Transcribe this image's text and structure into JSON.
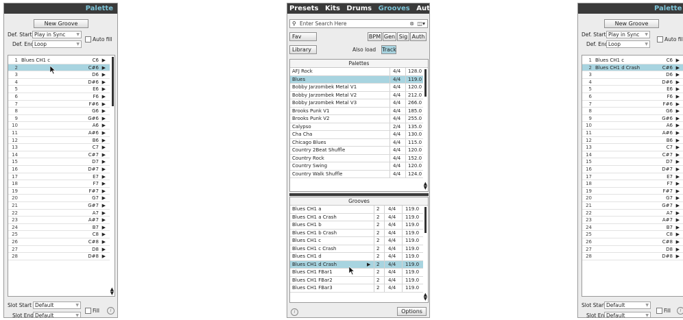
{
  "left": {
    "title": "Palette",
    "new_groove": "New Groove",
    "def_start_label": "Def. Start",
    "def_start_value": "Play in Sync",
    "def_end_label": "Def. End",
    "def_end_value": "Loop",
    "auto_fill": "Auto fill",
    "slot_start_label": "Slot Start",
    "slot_start_value": "Default",
    "slot_end_label": "Slot End",
    "slot_end_value": "Default",
    "fill": "Fill",
    "slots": [
      {
        "n": "1",
        "name": "Blues CH1 c",
        "chord": "C6"
      },
      {
        "n": "2",
        "name": "",
        "chord": "C#6"
      },
      {
        "n": "3",
        "name": "",
        "chord": "D6"
      },
      {
        "n": "4",
        "name": "",
        "chord": "D#6"
      },
      {
        "n": "5",
        "name": "",
        "chord": "E6"
      },
      {
        "n": "6",
        "name": "",
        "chord": "F6"
      },
      {
        "n": "7",
        "name": "",
        "chord": "F#6"
      },
      {
        "n": "8",
        "name": "",
        "chord": "G6"
      },
      {
        "n": "9",
        "name": "",
        "chord": "G#6"
      },
      {
        "n": "10",
        "name": "",
        "chord": "A6"
      },
      {
        "n": "11",
        "name": "",
        "chord": "A#6"
      },
      {
        "n": "12",
        "name": "",
        "chord": "B6"
      },
      {
        "n": "13",
        "name": "",
        "chord": "C7"
      },
      {
        "n": "14",
        "name": "",
        "chord": "C#7"
      },
      {
        "n": "15",
        "name": "",
        "chord": "D7"
      },
      {
        "n": "16",
        "name": "",
        "chord": "D#7"
      },
      {
        "n": "17",
        "name": "",
        "chord": "E7"
      },
      {
        "n": "18",
        "name": "",
        "chord": "F7"
      },
      {
        "n": "19",
        "name": "",
        "chord": "F#7"
      },
      {
        "n": "20",
        "name": "",
        "chord": "G7"
      },
      {
        "n": "21",
        "name": "",
        "chord": "G#7"
      },
      {
        "n": "22",
        "name": "",
        "chord": "A7"
      },
      {
        "n": "23",
        "name": "",
        "chord": "A#7"
      },
      {
        "n": "24",
        "name": "",
        "chord": "B7"
      },
      {
        "n": "25",
        "name": "",
        "chord": "C8"
      },
      {
        "n": "26",
        "name": "",
        "chord": "C#8"
      },
      {
        "n": "27",
        "name": "",
        "chord": "D8"
      },
      {
        "n": "28",
        "name": "",
        "chord": "D#8"
      }
    ]
  },
  "right": {
    "title": "Palette",
    "new_groove": "New Groove",
    "def_start_label": "Def. Start",
    "def_start_value": "Play in Sync",
    "def_end_label": "Def. End",
    "def_end_value": "Loop",
    "auto_fill": "Auto fill",
    "slot_start_label": "Slot Start",
    "slot_start_value": "Default",
    "slot_end_label": "Slot End",
    "slot_end_value": "Default",
    "fill": "Fill",
    "slots": [
      {
        "n": "1",
        "name": "Blues CH1 c",
        "chord": "C6"
      },
      {
        "n": "2",
        "name": "Blues CH1 d Crash",
        "chord": "C#6"
      },
      {
        "n": "3",
        "name": "",
        "chord": "D6"
      },
      {
        "n": "4",
        "name": "",
        "chord": "D#6"
      },
      {
        "n": "5",
        "name": "",
        "chord": "E6"
      },
      {
        "n": "6",
        "name": "",
        "chord": "F6"
      },
      {
        "n": "7",
        "name": "",
        "chord": "F#6"
      },
      {
        "n": "8",
        "name": "",
        "chord": "G6"
      },
      {
        "n": "9",
        "name": "",
        "chord": "G#6"
      },
      {
        "n": "10",
        "name": "",
        "chord": "A6"
      },
      {
        "n": "11",
        "name": "",
        "chord": "A#6"
      },
      {
        "n": "12",
        "name": "",
        "chord": "B6"
      },
      {
        "n": "13",
        "name": "",
        "chord": "C7"
      },
      {
        "n": "14",
        "name": "",
        "chord": "C#7"
      },
      {
        "n": "15",
        "name": "",
        "chord": "D7"
      },
      {
        "n": "16",
        "name": "",
        "chord": "D#7"
      },
      {
        "n": "17",
        "name": "",
        "chord": "E7"
      },
      {
        "n": "18",
        "name": "",
        "chord": "F7"
      },
      {
        "n": "19",
        "name": "",
        "chord": "F#7"
      },
      {
        "n": "20",
        "name": "",
        "chord": "G7"
      },
      {
        "n": "21",
        "name": "",
        "chord": "G#7"
      },
      {
        "n": "22",
        "name": "",
        "chord": "A7"
      },
      {
        "n": "23",
        "name": "",
        "chord": "A#7"
      },
      {
        "n": "24",
        "name": "",
        "chord": "B7"
      },
      {
        "n": "25",
        "name": "",
        "chord": "C8"
      },
      {
        "n": "26",
        "name": "",
        "chord": "C#8"
      },
      {
        "n": "27",
        "name": "",
        "chord": "D8"
      },
      {
        "n": "28",
        "name": "",
        "chord": "D#8"
      }
    ]
  },
  "browser": {
    "tabs": [
      "Presets",
      "Kits",
      "Drums",
      "Grooves",
      "Auto"
    ],
    "active_tab": "Grooves",
    "search_placeholder": "Enter Search Here",
    "fav": "Fav",
    "bpm": "BPM",
    "gen": "Gen",
    "sig": "Sig",
    "auth": "Auth",
    "library": "Library",
    "also_load": "Also load",
    "track": "Track",
    "palettes_header": "Palettes",
    "palettes": [
      {
        "name": "AFJ Rock",
        "sig": "4/4",
        "bpm": "128.0"
      },
      {
        "name": "Blues",
        "sig": "4/4",
        "bpm": "119.0"
      },
      {
        "name": "Bobby Jarzombek Metal V1",
        "sig": "4/4",
        "bpm": "120.0"
      },
      {
        "name": "Bobby Jarzombek Metal V2",
        "sig": "4/4",
        "bpm": "212.0"
      },
      {
        "name": "Bobby Jarzombek Metal V3",
        "sig": "4/4",
        "bpm": "266.0"
      },
      {
        "name": "Brooks Punk V1",
        "sig": "4/4",
        "bpm": "185.0"
      },
      {
        "name": "Brooks Punk V2",
        "sig": "4/4",
        "bpm": "255.0"
      },
      {
        "name": "Calypso",
        "sig": "2/4",
        "bpm": "135.0"
      },
      {
        "name": "Cha Cha",
        "sig": "4/4",
        "bpm": "130.0"
      },
      {
        "name": "Chicago Blues",
        "sig": "4/4",
        "bpm": "115.0"
      },
      {
        "name": "Country 2Beat Shuffle",
        "sig": "4/4",
        "bpm": "120.0"
      },
      {
        "name": "Country Rock",
        "sig": "4/4",
        "bpm": "152.0"
      },
      {
        "name": "Country Swing",
        "sig": "4/4",
        "bpm": "120.0"
      },
      {
        "name": "Country Walk Shuffle",
        "sig": "4/4",
        "bpm": "124.0"
      }
    ],
    "grooves_header": "Grooves",
    "grooves": [
      {
        "name": "Blues CH1 a",
        "bars": "2",
        "sig": "4/4",
        "bpm": "119.0"
      },
      {
        "name": "Blues CH1 a Crash",
        "bars": "2",
        "sig": "4/4",
        "bpm": "119.0"
      },
      {
        "name": "Blues CH1 b",
        "bars": "2",
        "sig": "4/4",
        "bpm": "119.0"
      },
      {
        "name": "Blues CH1 b Crash",
        "bars": "2",
        "sig": "4/4",
        "bpm": "119.0"
      },
      {
        "name": "Blues CH1 c",
        "bars": "2",
        "sig": "4/4",
        "bpm": "119.0"
      },
      {
        "name": "Blues CH1 c Crash",
        "bars": "2",
        "sig": "4/4",
        "bpm": "119.0"
      },
      {
        "name": "Blues CH1 d",
        "bars": "2",
        "sig": "4/4",
        "bpm": "119.0"
      },
      {
        "name": "Blues CH1 d Crash",
        "bars": "2",
        "sig": "4/4",
        "bpm": "119.0"
      },
      {
        "name": "Blues CH1 FBar1",
        "bars": "2",
        "sig": "4/4",
        "bpm": "119.0"
      },
      {
        "name": "Blues CH1 FBar2",
        "bars": "2",
        "sig": "4/4",
        "bpm": "119.0"
      },
      {
        "name": "Blues CH1 FBar3",
        "bars": "2",
        "sig": "4/4",
        "bpm": "119.0"
      }
    ],
    "options": "Options"
  }
}
